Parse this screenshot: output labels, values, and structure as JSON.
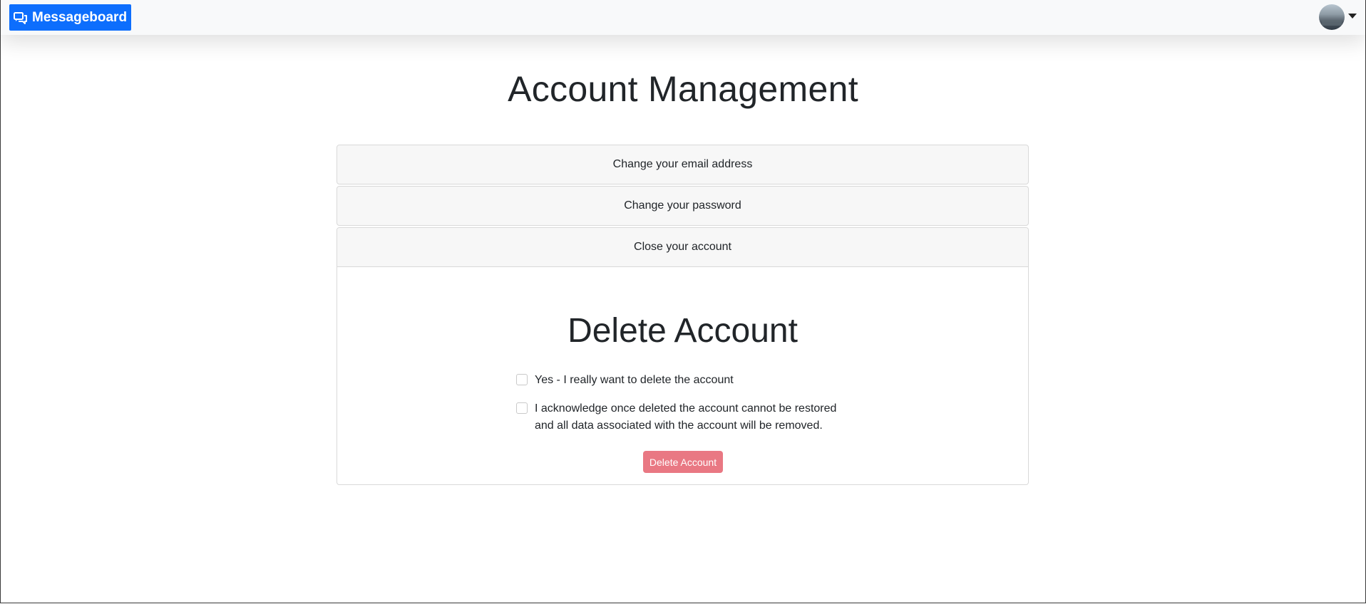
{
  "navbar": {
    "brand_label": "Messageboard",
    "brand_icon": "chat-bubbles-icon",
    "avatar_icon": "avatar",
    "dropdown_icon": "caret-down-icon"
  },
  "page": {
    "title": "Account Management"
  },
  "accordion": {
    "items": [
      {
        "label": "Change your email address"
      },
      {
        "label": "Change your password"
      },
      {
        "label": "Close your account"
      }
    ]
  },
  "delete_section": {
    "title": "Delete Account",
    "confirm_1": "Yes - I really want to delete the account",
    "confirm_2": "I acknowledge once deleted the account cannot be restored and all data associated with the account will be removed.",
    "button_label": "Delete Account"
  },
  "colors": {
    "brand": "#0d6efd",
    "danger_disabled": "#e97883",
    "navbar_bg": "#f8f9fa"
  }
}
